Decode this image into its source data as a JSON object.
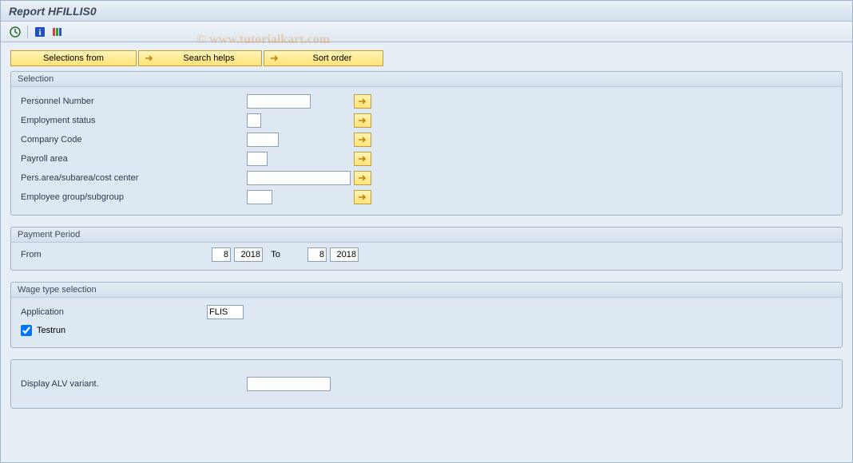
{
  "title": "Report HFILLIS0",
  "watermark": "© www.tutorialkart.com",
  "toolbar_buttons": {
    "selections_from": "Selections from",
    "search_helps": "Search helps",
    "sort_order": "Sort order"
  },
  "groups": {
    "selection": {
      "title": "Selection",
      "fields": {
        "personnel_number": {
          "label": "Personnel Number",
          "value": ""
        },
        "employment_status": {
          "label": "Employment status",
          "value": ""
        },
        "company_code": {
          "label": "Company Code",
          "value": ""
        },
        "payroll_area": {
          "label": "Payroll area",
          "value": ""
        },
        "pers_area": {
          "label": "Pers.area/subarea/cost center",
          "value": ""
        },
        "employee_group": {
          "label": "Employee group/subgroup",
          "value": ""
        }
      }
    },
    "payment_period": {
      "title": "Payment Period",
      "from_label": "From",
      "to_label": "To",
      "from_month": "8",
      "from_year": "2018",
      "to_month": "8",
      "to_year": "2018"
    },
    "wage_type": {
      "title": "Wage type selection",
      "application_label": "Application",
      "application_value": "FLIS",
      "testrun_label": "Testrun",
      "testrun_checked": true
    },
    "alv": {
      "label": "Display ALV variant.",
      "value": ""
    }
  }
}
